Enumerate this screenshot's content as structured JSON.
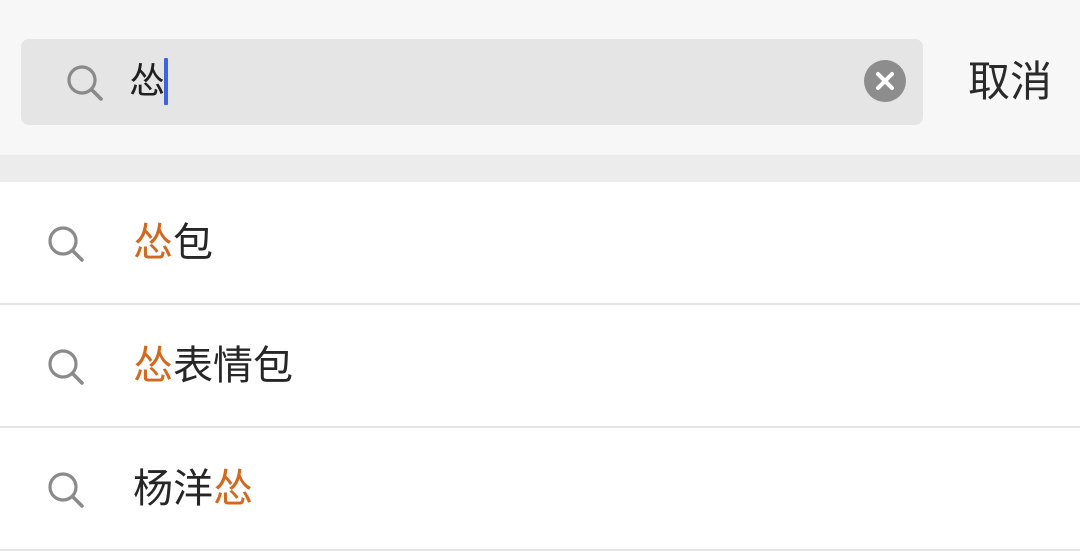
{
  "search": {
    "query": "怂",
    "placeholder": "",
    "cancel_label": "取消"
  },
  "icons": {
    "search": "search-icon",
    "clear": "clear-icon"
  },
  "colors": {
    "highlight": "#d2691e",
    "caret": "#3b63e6",
    "text": "#262626",
    "search_field_bg": "#e5e5e5"
  },
  "suggestions": [
    {
      "highlight": "怂",
      "rest": "包",
      "before": ""
    },
    {
      "highlight": "怂",
      "rest": "表情包",
      "before": ""
    },
    {
      "before": "杨洋",
      "highlight": "怂",
      "rest": ""
    }
  ]
}
